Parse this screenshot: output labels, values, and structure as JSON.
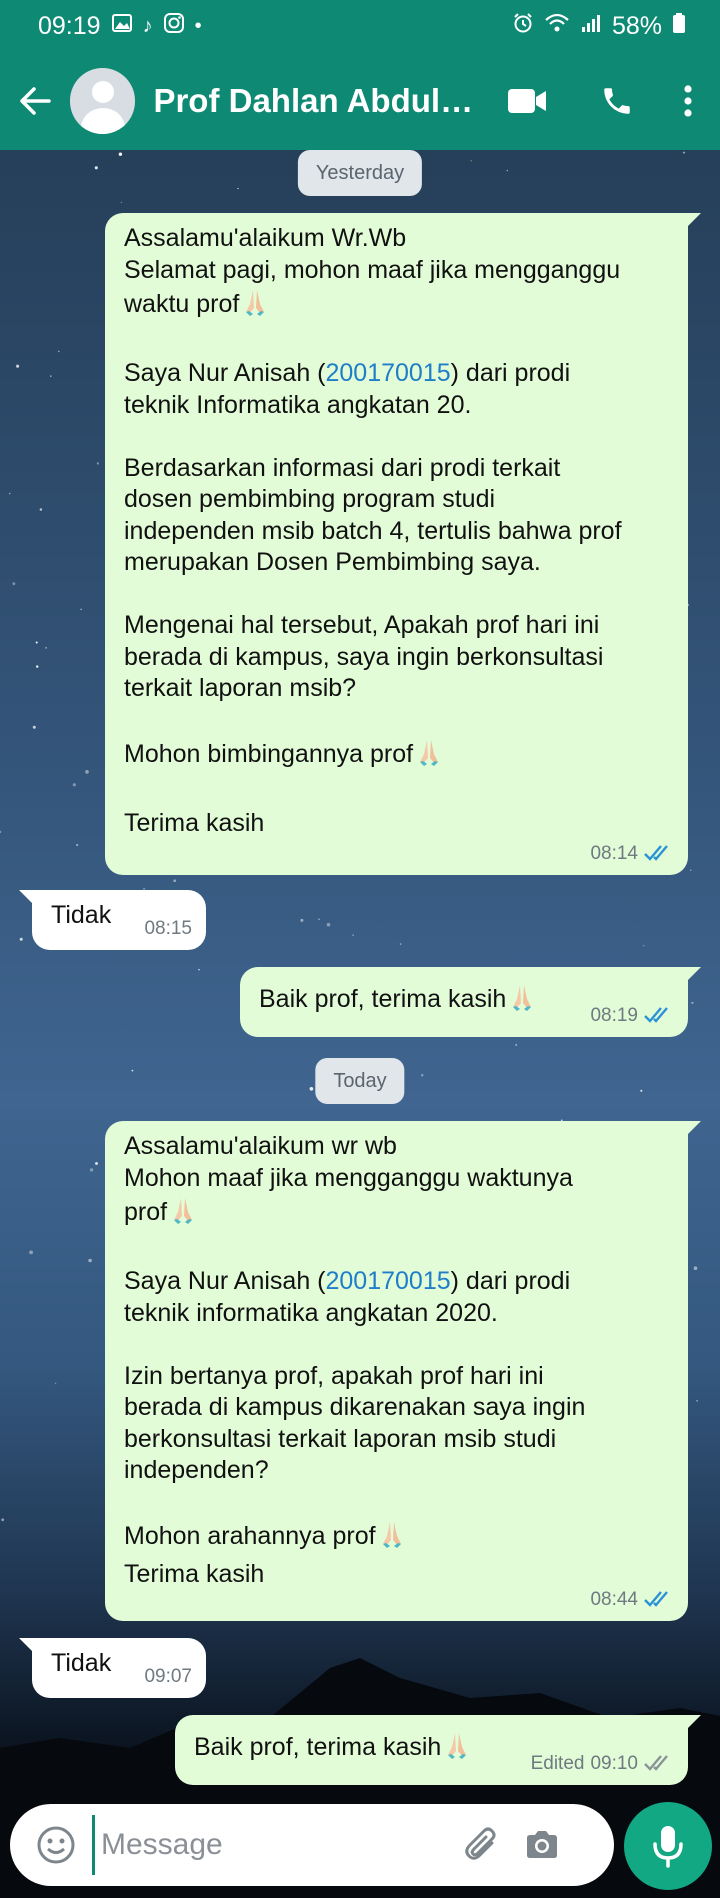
{
  "status_bar": {
    "time": "09:19",
    "battery": "58%"
  },
  "header": {
    "contact_name": "Prof Dahlan Abdullah"
  },
  "colors": {
    "header": "#0e8a74",
    "outgoing_bubble": "#e3fcd8",
    "incoming_bubble": "#ffffff",
    "link": "#1e7ec8",
    "ticks_read": "#2a93d5",
    "mic_button": "#13a884"
  },
  "icons": [
    "back-arrow-icon",
    "avatar-icon",
    "video-call-icon",
    "phone-icon",
    "more-vert-icon",
    "emoji-icon",
    "attach-icon",
    "camera-icon",
    "mic-icon",
    "double-check-icon",
    "praying-hands-emoji"
  ],
  "chat": {
    "date_yesterday": "Yesterday",
    "date_today": "Today",
    "m1": {
      "l1": "Assalamu'alaikum Wr.Wb",
      "l2": "Selamat pagi, mohon maaf jika mengganggu",
      "l3": "waktu prof",
      "l4a": "Saya Nur Anisah (",
      "l4num": "200170015",
      "l4b": ") dari prodi",
      "l5": "teknik Informatika angkatan 20.",
      "l6": "Berdasarkan informasi dari prodi terkait",
      "l7": "dosen pembimbing program studi",
      "l8": "independen msib batch 4, tertulis bahwa prof",
      "l9": "merupakan Dosen Pembimbing saya.",
      "l10": "Mengenai hal tersebut, Apakah prof hari ini",
      "l11": "berada di kampus, saya ingin berkonsultasi",
      "l12": "terkait laporan msib?",
      "l13": "Mohon bimbingannya prof",
      "l14": "Terima kasih",
      "time": "08:14"
    },
    "m2": {
      "text": "Tidak",
      "time": "08:15"
    },
    "m3": {
      "text": "Baik prof, terima kasih",
      "time": "08:19"
    },
    "m4": {
      "l1": "Assalamu'alaikum wr wb",
      "l2": "Mohon maaf jika mengganggu waktunya",
      "l3": "prof",
      "l4a": "Saya Nur Anisah (",
      "l4num": "200170015",
      "l4b": ") dari prodi",
      "l5": "teknik informatika angkatan 2020.",
      "l6": "Izin bertanya prof, apakah prof hari ini",
      "l7": "berada di kampus dikarenakan saya ingin",
      "l8": "berkonsultasi terkait laporan msib studi",
      "l9": "independen?",
      "l10": "Mohon arahannya prof",
      "l11": "Terima kasih",
      "time": "08:44"
    },
    "m5": {
      "text": "Tidak",
      "time": "09:07"
    },
    "m6": {
      "text": "Baik prof, terima kasih",
      "edited": "Edited",
      "time": "09:10"
    }
  },
  "input": {
    "placeholder": "Message"
  }
}
